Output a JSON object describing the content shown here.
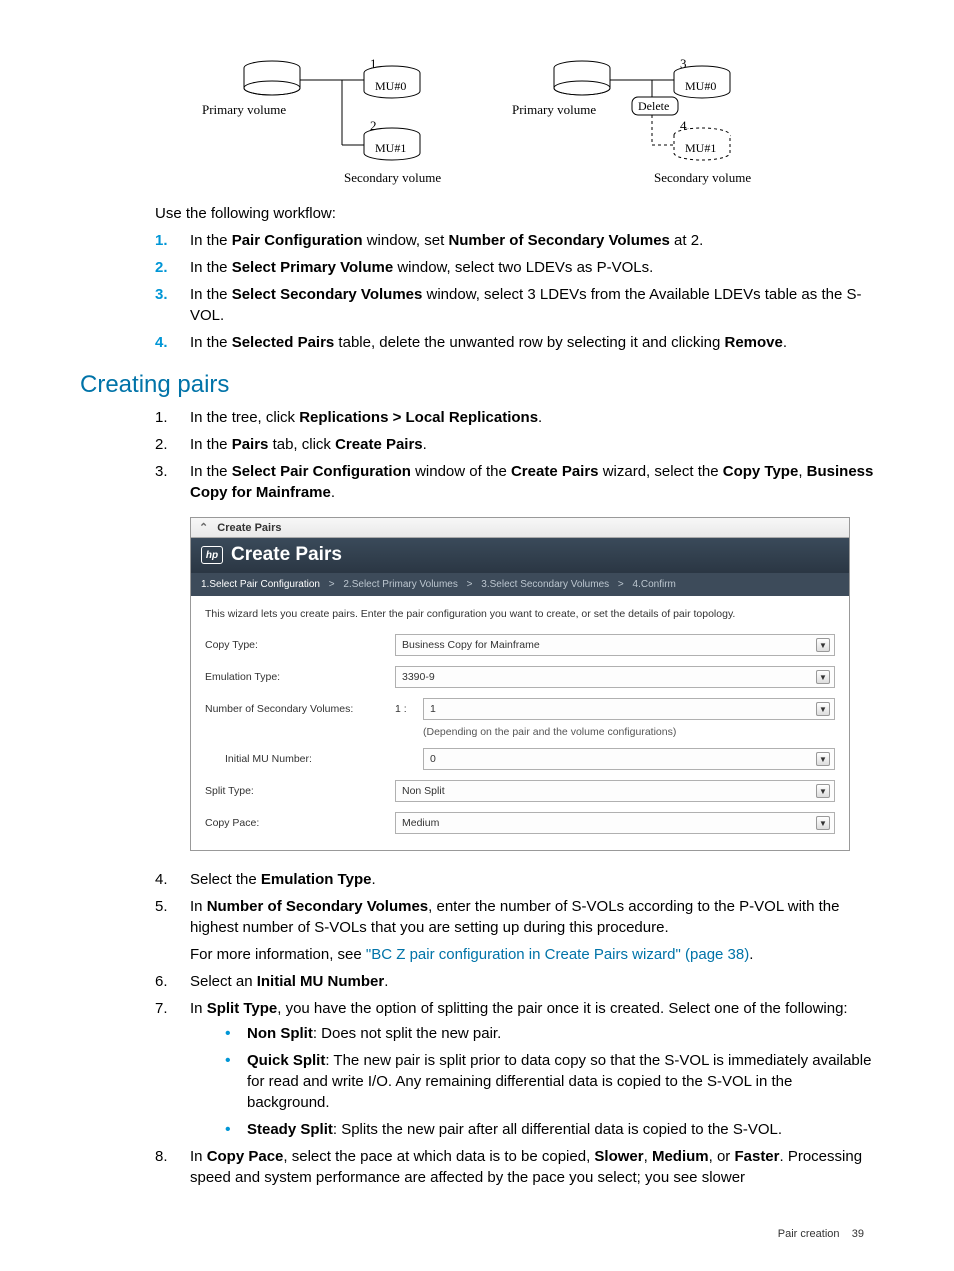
{
  "diagram": {
    "left": {
      "primary": "Primary volume",
      "n1": "1.",
      "mu0": "MU#0",
      "n2": "2.",
      "mu1": "MU#1",
      "caption": "Secondary volume"
    },
    "right": {
      "primary": "Primary volume",
      "n3": "3.",
      "mu0": "MU#0",
      "delete": "Delete",
      "n4": "4.",
      "mu1": "MU#1",
      "caption": "Secondary volume"
    }
  },
  "workflow_intro": "Use the following workflow:",
  "workflow": [
    {
      "n": "1.",
      "pre": "In the ",
      "b1": "Pair Configuration",
      "mid": " window, set ",
      "b2": "Number of Secondary Volumes",
      "post": " at 2."
    },
    {
      "n": "2.",
      "pre": "In the ",
      "b1": "Select Primary Volume",
      "mid": " window, select two LDEVs as P-VOLs.",
      "b2": "",
      "post": ""
    },
    {
      "n": "3.",
      "pre": "In the ",
      "b1": "Select Secondary Volumes",
      "mid": " window, select 3 LDEVs from the Available LDEVs table as the S-VOL.",
      "b2": "",
      "post": ""
    },
    {
      "n": "4.",
      "pre": "In the ",
      "b1": "Selected Pairs",
      "mid": " table, delete the unwanted row by selecting it and clicking ",
      "b2": "Remove",
      "post": "."
    }
  ],
  "heading": "Creating pairs",
  "steps_a": [
    {
      "n": "1.",
      "pre": "In the tree, click ",
      "b1": "Replications > Local Replications",
      "post": "."
    },
    {
      "n": "2.",
      "pre": "In the ",
      "b1": "Pairs",
      "mid": " tab, click ",
      "b2": "Create Pairs",
      "post": "."
    },
    {
      "n": "3.",
      "pre": "In the ",
      "b1": "Select Pair Configuration",
      "mid": " window of the ",
      "b2": "Create Pairs",
      "mid2": " wizard, select the ",
      "b3": "Copy Type",
      "post": ", ",
      "b4": "Business Copy for Mainframe",
      "post2": "."
    }
  ],
  "wizard": {
    "panel_title": "Create Pairs",
    "title": "Create Pairs",
    "steps": {
      "s1": "1.Select Pair Configuration",
      "s2": "2.Select Primary Volumes",
      "s3": "3.Select Secondary Volumes",
      "s4": "4.Confirm",
      "sep": ">"
    },
    "desc": "This wizard lets you create pairs. Enter the pair configuration you want to create, or set the details of pair topology.",
    "rows": {
      "copy_type_label": "Copy Type:",
      "copy_type_value": "Business Copy for Mainframe",
      "emu_label": "Emulation Type:",
      "emu_value": "3390-9",
      "nsv_label": "Number of Secondary Volumes:",
      "nsv_prefix": "1 :",
      "nsv_value": "1",
      "nsv_hint": "(Depending on the pair and the volume configurations)",
      "imu_label": "Initial MU Number:",
      "imu_value": "0",
      "split_label": "Split Type:",
      "split_value": "Non Split",
      "pace_label": "Copy Pace:",
      "pace_value": "Medium"
    }
  },
  "steps_b": [
    {
      "n": "4.",
      "pre": "Select the ",
      "b1": "Emulation Type",
      "post": "."
    },
    {
      "n": "5.",
      "pre": "In ",
      "b1": "Number of Secondary Volumes",
      "post": ", enter the number of S-VOLs according to the P-VOL with the highest number of S-VOLs that you are setting up during this procedure.",
      "extra_pre": "For more information, see ",
      "extra_link": "\"BC Z pair configuration in Create Pairs wizard\" (page 38)",
      "extra_post": "."
    },
    {
      "n": "6.",
      "pre": "Select an ",
      "b1": "Initial MU Number",
      "post": "."
    },
    {
      "n": "7.",
      "pre": "In ",
      "b1": "Split Type",
      "post": ", you have the option of splitting the pair once it is created. Select one of the following:"
    }
  ],
  "split_options": [
    {
      "b": "Non Split",
      "t": ": Does not split the new pair."
    },
    {
      "b": "Quick Split",
      "t": ": The new pair is split prior to data copy so that the S-VOL is immediately available for read and write I/O. Any remaining differential data is copied to the S-VOL in the background."
    },
    {
      "b": "Steady Split",
      "t": ": Splits the new pair after all differential data is copied to the S-VOL."
    }
  ],
  "step8": {
    "n": "8.",
    "pre": "In ",
    "b1": "Copy Pace",
    "mid": ", select the pace at which data is to be copied, ",
    "b2": "Slower",
    "sep": ", ",
    "b3": "Medium",
    "sep2": ", or ",
    "b4": "Faster",
    "post": ". Processing speed and system performance are affected by the pace you select; you see slower"
  },
  "footer": {
    "section": "Pair creation",
    "page": "39"
  }
}
